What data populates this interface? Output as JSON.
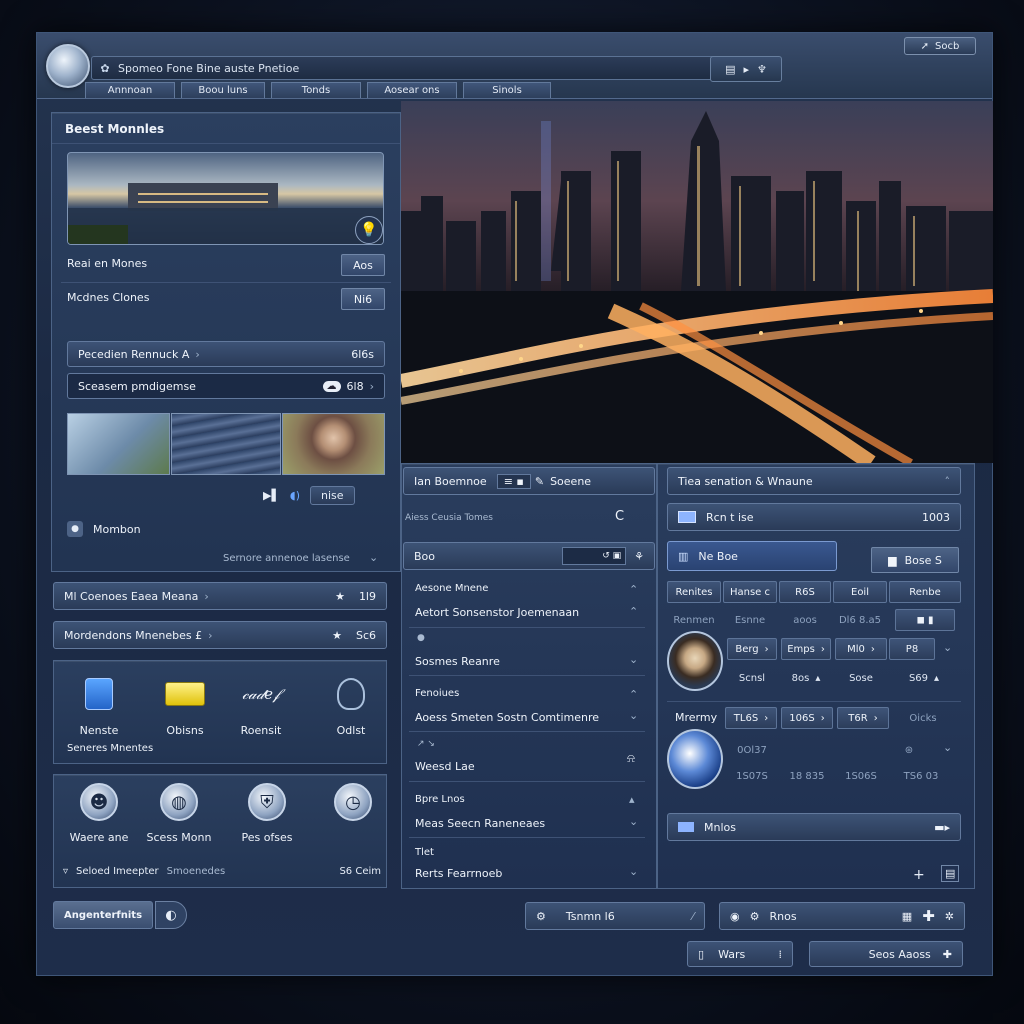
{
  "titlebar": {
    "address": "Spomeo Fone Bine auste Pnetioe",
    "submit_label": "Socb",
    "tabs": [
      "Annnoan",
      "Boou luns",
      "Tonds",
      "Aosear ons",
      "Sinols"
    ]
  },
  "left": {
    "panel_title": "Beest Monnles",
    "rows": [
      {
        "label": "Reai en Mones",
        "button": "Aos"
      },
      {
        "label": "Mcdnes Clones",
        "button": "Ni6"
      }
    ],
    "fields": [
      {
        "label": "Pecedien Rennuck A",
        "value": "6l6s"
      },
      {
        "label": "Sceasem pmdigemse",
        "value": "6l8"
      }
    ],
    "media_controls_label": "nise",
    "mention_label": "Mombon",
    "section_footer": "Sernore annenoe lasense",
    "list": [
      {
        "label": "Ml Coenoes Eaea Meana",
        "value": "1l9"
      },
      {
        "label": "Mordendons Mnenebes £",
        "value": "Sc6"
      }
    ],
    "tiles_row1": [
      "Nenste",
      "Obisns",
      "Roensit",
      "Odlst"
    ],
    "tiles_row1_caption": "Seneres Mnentes",
    "tiles_row2": [
      "Waere ane",
      "Scess Monn",
      "Pes ofses"
    ],
    "status_left": "Seloed Imeepter",
    "status_mid": "Smoenedes",
    "status_right": "S6 Ceim",
    "bottom_button": "Angenterfnits"
  },
  "mid": {
    "header_left": "Ian Boemnoe",
    "header_right": "Soeene",
    "sub_label": "Aiess Ceusia Tomes",
    "sub_icon": "C",
    "search_label": "Boo",
    "sections": [
      {
        "title": "Aesone Mnene",
        "item": "Aetort Sonsenstor Joemenaan"
      },
      {
        "title": "",
        "item": "Sosmes Reanre"
      },
      {
        "title": "Fenoiues",
        "item": "Aoess Smeten Sostn Comtimenre"
      },
      {
        "title": "",
        "item": "Weesd Lae"
      },
      {
        "title": "Bpre Lnos",
        "item": "Meas Seecn Raneneaes"
      },
      {
        "title": "Tlet",
        "item": "Rerts Fearrnoeb"
      }
    ],
    "bottom_button": "Tsnmn l6"
  },
  "right": {
    "header": "Tiea senation & Wnaune",
    "row1_label": "Rcn t ise",
    "row1_value": "1003",
    "selected_label": "Ne Boe",
    "side_button": "Bose S",
    "table_headers": [
      "Renites",
      "Hanse c",
      "R6S",
      "Eoil",
      "Renbe"
    ],
    "table_row2": [
      "Renmen",
      "Esnne",
      "aoos",
      "Dl6 8.a5",
      ""
    ],
    "table_row3": [
      "Berg",
      "Emps",
      "Ml0",
      "P8"
    ],
    "table_row4": [
      "Scnsl",
      "8os",
      "Sose",
      "S69"
    ],
    "second_block_label": "Mrermy",
    "second_block_cells": [
      "TL6S",
      "106S",
      "T6R"
    ],
    "second_block_extra": "Oicks",
    "faded_row1": [
      "0Ol37",
      "",
      ""
    ],
    "faded_row2": [
      "1S07S",
      "18 835",
      "1S06S",
      "TS6 03"
    ],
    "footer_label": "Mnlos",
    "bottom_button": "Rnos"
  },
  "footer": {
    "left_button": "Wars",
    "right_button": "Seos Aaoss"
  }
}
